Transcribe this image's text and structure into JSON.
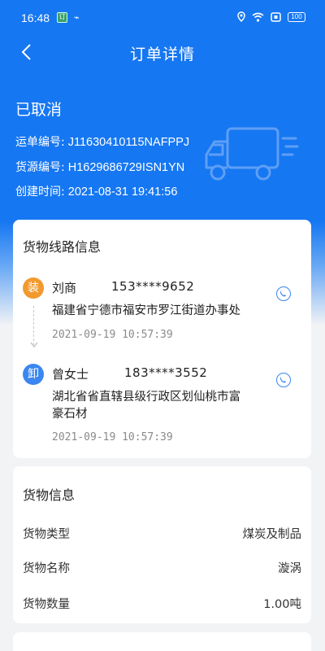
{
  "status_bar": {
    "time": "16:48",
    "battery": "100"
  },
  "nav": {
    "title": "订单详情"
  },
  "order": {
    "status": "已取消",
    "waybill_label": "运单编号:",
    "waybill_value": "J11630410115NAFPPJ",
    "source_label": "货源编号:",
    "source_value": "H1629686729ISN1YN",
    "created_label": "创建时间:",
    "created_value": "2021-08-31 19:41:56"
  },
  "route": {
    "title": "货物线路信息",
    "load": {
      "badge": "装",
      "name": "刘商",
      "phone": "153****9652",
      "address": "福建省宁德市福安市罗江街道办事处",
      "time": "2021-09-19 10:57:39"
    },
    "unload": {
      "badge": "卸",
      "name": "曾女士",
      "phone": "183****3552",
      "address_line1": "湖北省省直辖县级行政区划仙桃市富",
      "address_line2": "豪石材",
      "time": "2021-09-19 10:57:39"
    }
  },
  "cargo": {
    "title": "货物信息",
    "rows": [
      {
        "label": "货物类型",
        "value": "煤炭及制品"
      },
      {
        "label": "货物名称",
        "value": "漩涡"
      },
      {
        "label": "货物数量",
        "value": "1.00吨"
      }
    ]
  },
  "colors": {
    "primary": "#1677f2",
    "load_badge": "#f29a2e",
    "unload_badge": "#3b86f0"
  }
}
